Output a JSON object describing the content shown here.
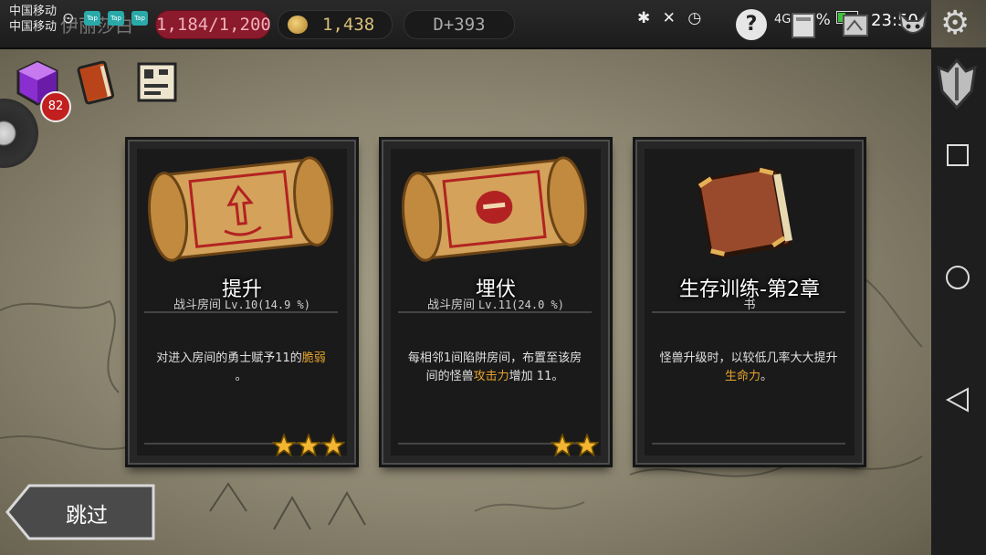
{
  "status_bar": {
    "carrier_1": "中国移动",
    "carrier_2": "中国移动",
    "battery": "43%",
    "time": "23:50",
    "signal_text": "4G"
  },
  "top_bar": {
    "hero_name": "伊丽莎白",
    "tap_badges": [
      "Tap",
      "Tap",
      "Tap"
    ],
    "hp": "1,184/1,200",
    "gold": "1,438",
    "day": "D+393",
    "help": "?"
  },
  "inventory": {
    "cube_count": "82"
  },
  "cards": [
    {
      "title": "提升",
      "subtitle": "战斗房间",
      "level": "Lv.10(14.9 %)",
      "desc_before": "对进入房间的勇士赋予11的",
      "desc_highlight": "脆弱",
      "desc_after": "。",
      "stars": 3,
      "image": "scroll-icon"
    },
    {
      "title": "埋伏",
      "subtitle": "战斗房间",
      "level": "Lv.11(24.0 %)",
      "desc_before": "每相邻1间陷阱房间，布置至该房间的怪兽",
      "desc_highlight": "攻击力",
      "desc_after": "增加 11。",
      "stars": 2,
      "image": "scroll-icon"
    },
    {
      "title": "生存训练-第2章",
      "subtitle": "书",
      "level": "",
      "desc_before": "怪兽升级时，以较低几率大大提升",
      "desc_highlight": "生命力",
      "desc_after": "。",
      "stars": 0,
      "image": "book-icon"
    }
  ],
  "skip_button": {
    "label": "跳过"
  },
  "colors": {
    "highlight": "#e6a22c",
    "hp_pill": "#8b1a2c",
    "badge": "#2aa9a9"
  }
}
